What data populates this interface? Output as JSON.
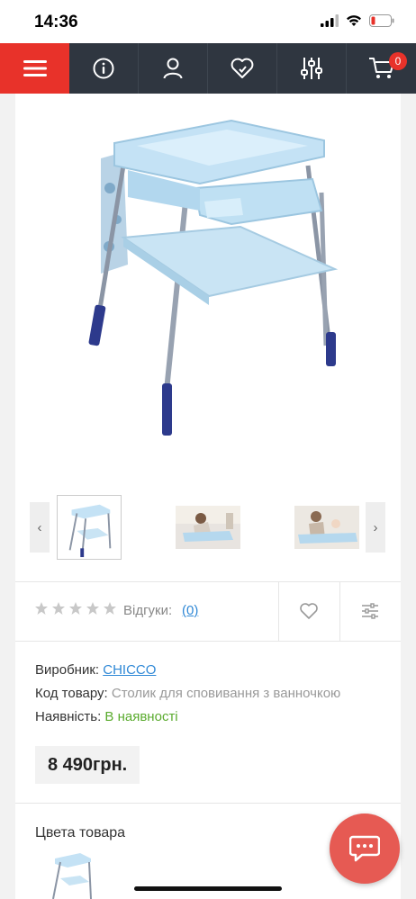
{
  "status_bar": {
    "time": "14:36"
  },
  "nav": {
    "items": [
      {
        "icon": "menu-icon"
      },
      {
        "icon": "info-icon"
      },
      {
        "icon": "user-icon"
      },
      {
        "icon": "heart-icon"
      },
      {
        "icon": "filters-icon"
      },
      {
        "icon": "cart-icon"
      }
    ],
    "cart_count": "0",
    "menu_color": "#e8322a",
    "bar_color": "#2f3640"
  },
  "gallery": {
    "prev_label": "‹",
    "next_label": "›"
  },
  "rating": {
    "stars": 0,
    "max_stars": 5,
    "reviews_label": "Відгуки:",
    "reviews_count": "(0)"
  },
  "product": {
    "manufacturer_label": "Виробник:",
    "manufacturer_value": "CHICCO",
    "code_label": "Код товару:",
    "code_value": "Столик для сповивання з ванночкою",
    "availability_label": "Наявність:",
    "availability_value": "В наявності",
    "price": "8 490грн."
  },
  "colors": {
    "title": "Цвета товара"
  }
}
